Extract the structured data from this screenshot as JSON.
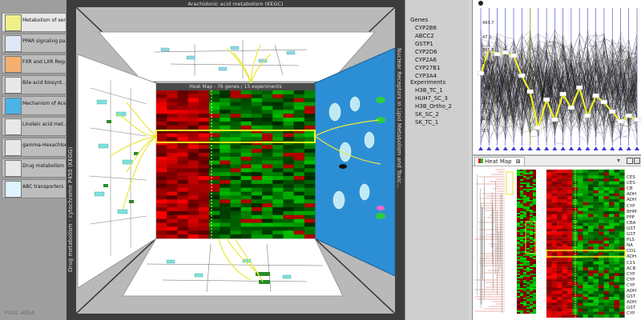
{
  "pool": {
    "title": "POOL AREA",
    "items": [
      {
        "label": "Metabolism of xen...",
        "selected": true
      },
      {
        "label": "PPAR signaling pa..."
      },
      {
        "label": "FXR and LXR Regul..."
      },
      {
        "label": "Bile acid biosynt..."
      },
      {
        "label": "Mechanism of Acet..."
      },
      {
        "label": "Linoleic acid met..."
      },
      {
        "label": "gamma-Hexachlor..."
      },
      {
        "label": "Drug metabolism -..."
      },
      {
        "label": "ABC transporters ..."
      }
    ]
  },
  "main": {
    "top_title": "Arachidonic acid metabolism (KEGC)",
    "left_title": "Drug metabolism - cytochrome P450 (KEGG)",
    "right_title": "Nuclear Receptors in Lipid Metabolism and Toxic...",
    "center_title": "Heat Map - 76 genes / 15 experiments"
  },
  "selection": {
    "genes_label": "Genes",
    "genes": [
      "CYP2B6",
      "ABCC2",
      "GSTP1",
      "CYP2D6",
      "CYP2A6",
      "CYP27B1",
      "CYP3A4"
    ],
    "experiments_label": "Experiments",
    "experiments": [
      "H3B_TC_1",
      "HUH7_SC_3",
      "H3B_Ortho_2",
      "SK_SC_2",
      "SK_TC_1"
    ]
  },
  "parallel_coords": {
    "axis_ticks": [
      "493.7",
      "47.3",
      "395.8",
      "106.8",
      "4.0",
      "2.0",
      "0.6",
      "0.3"
    ],
    "accent": "#f1f12a"
  },
  "heatmap_view": {
    "tab_label": "Heat Map",
    "close_glyph": "⊠",
    "menu_glyph": "▾",
    "row_labels": [
      "CES",
      "CES",
      "CB",
      "ADH",
      "ADH",
      "CYP",
      "BHM",
      "PPP",
      "CBA",
      "GST",
      "GST",
      "PLS",
      "NA",
      "CD1",
      "ADH",
      "C1S",
      "ACB",
      "CYP",
      "CYP",
      "CYP",
      "ADH",
      "GST",
      "ADH",
      "GST",
      "CYP"
    ]
  },
  "colors": {
    "highlight": "#f4f420",
    "heat_red": "#d9181b",
    "heat_green": "#24c824",
    "pathway_blue": "#2c8fd6"
  }
}
